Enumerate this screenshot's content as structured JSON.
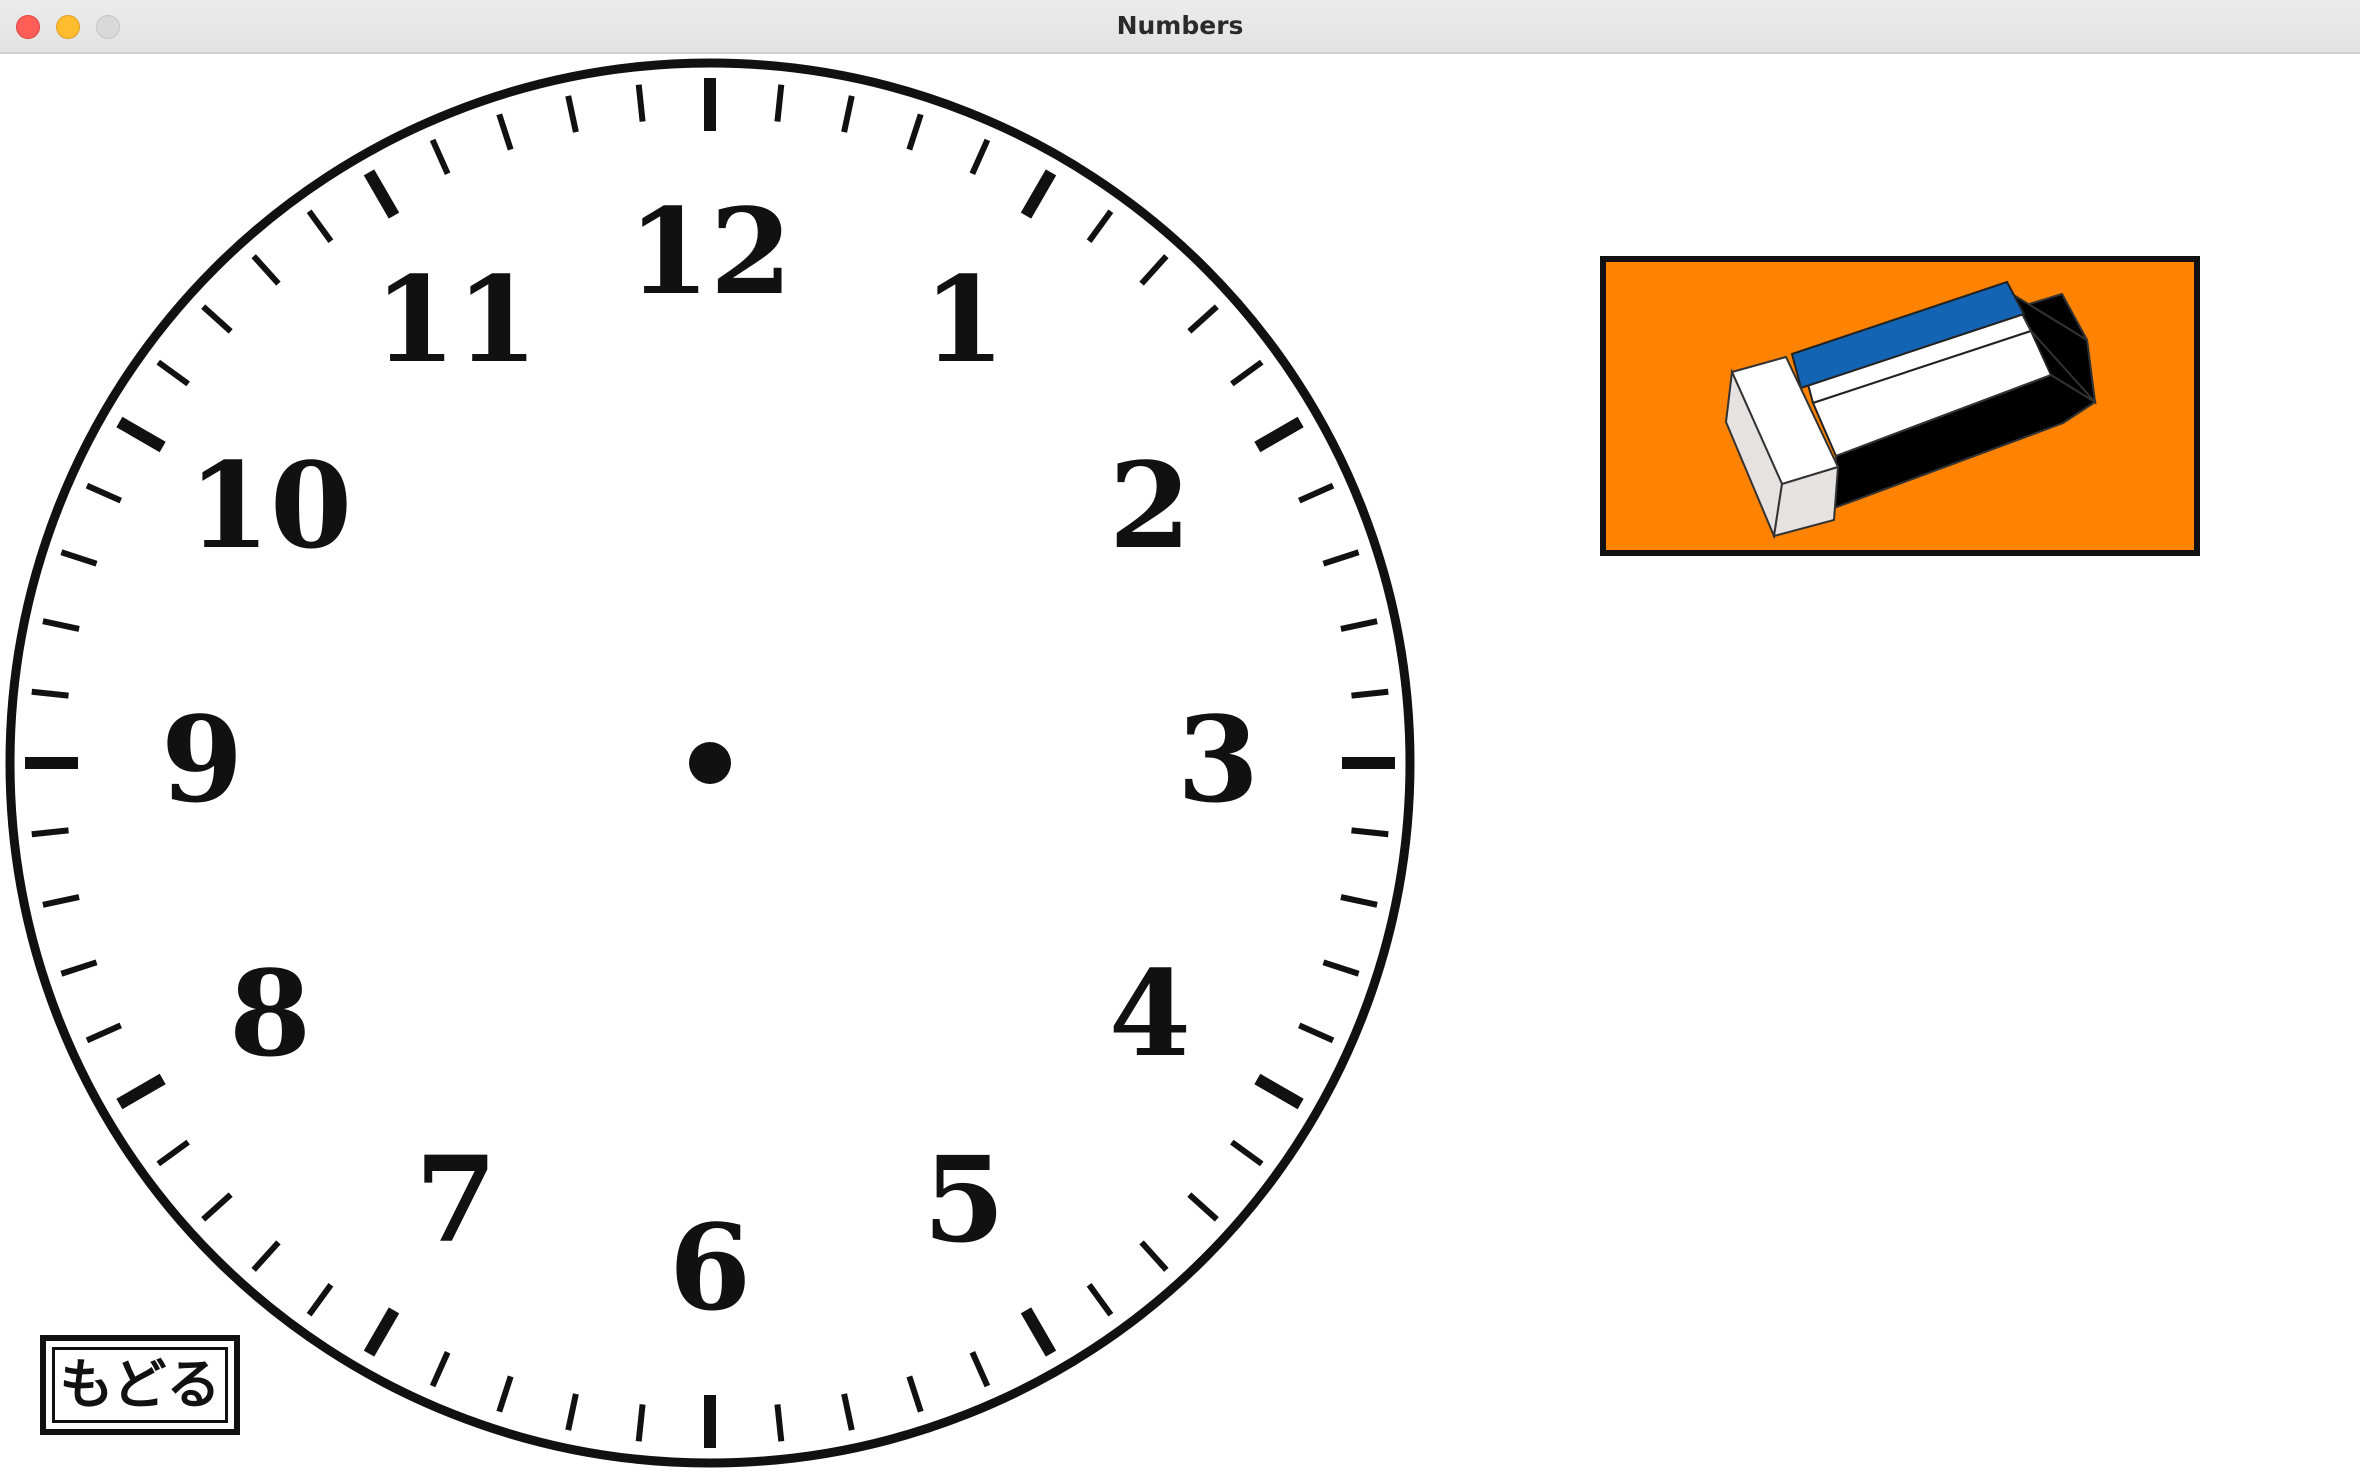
{
  "window": {
    "title": "Numbers"
  },
  "clock": {
    "numerals": [
      "12",
      "1",
      "2",
      "3",
      "4",
      "5",
      "6",
      "7",
      "8",
      "9",
      "10",
      "11"
    ],
    "face_color": "#ffffff",
    "ink_color": "#111111"
  },
  "eraser_button": {
    "icon": "eraser-icon",
    "background_color": "#ff8200",
    "sleeve_blue": "#1464b4",
    "sleeve_black": "#000000"
  },
  "back_button": {
    "label": "もどる"
  }
}
